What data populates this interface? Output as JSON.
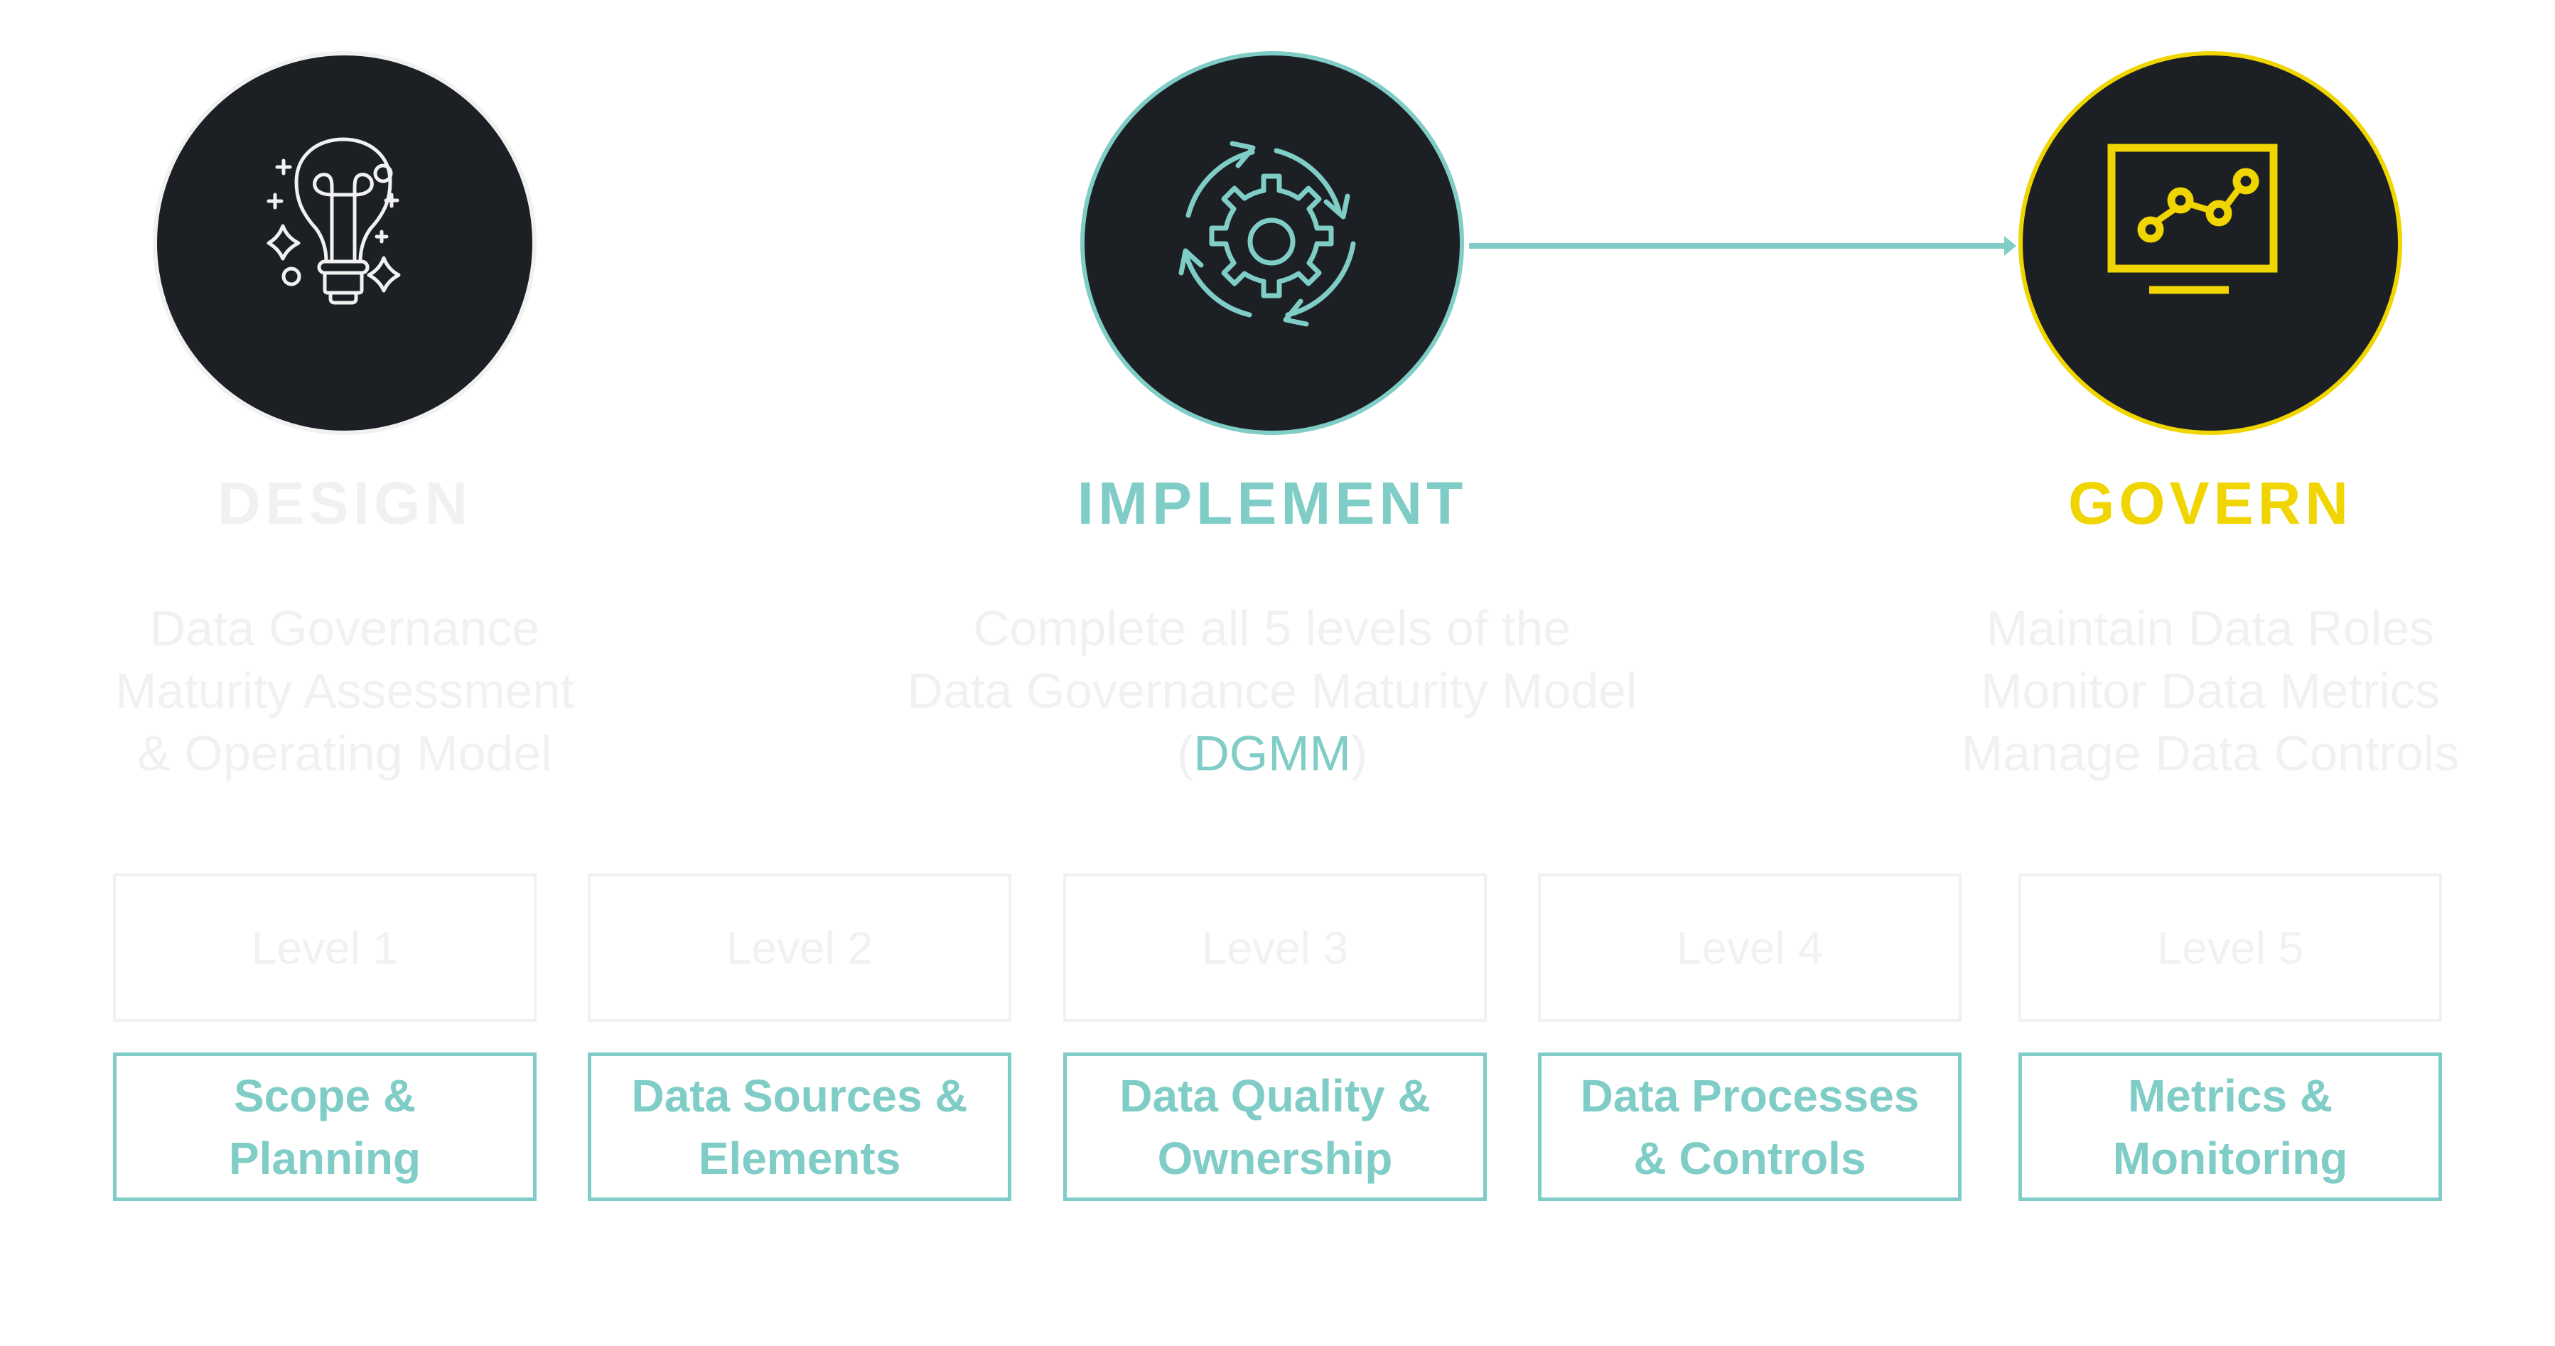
{
  "colors": {
    "circle_fill": "#1c2024",
    "teal": "#7fcdc6",
    "yellow": "#f0d500",
    "light_gray": "#f1f1f1"
  },
  "phases": [
    {
      "id": "design",
      "title": "DESIGN",
      "icon": "lightbulb-icon",
      "description": [
        "Data Governance",
        "Maturity Assessment",
        "& Operating Model"
      ]
    },
    {
      "id": "implement",
      "title": "IMPLEMENT",
      "icon": "gear-cycle-icon",
      "description": [
        "Complete all 5 levels of the",
        "Data Governance Maturity Model"
      ],
      "description_open": "(",
      "description_highlight": "DGMM",
      "description_close": ")"
    },
    {
      "id": "govern",
      "title": "GOVERN",
      "icon": "monitor-chart-icon",
      "description": [
        "Maintain Data Roles",
        "Monitor Data Metrics",
        "Manage Data Controls"
      ]
    }
  ],
  "connector": {
    "from": "implement",
    "to": "govern",
    "icon": "arrow-right-icon"
  },
  "levels": [
    {
      "label": "Level 1",
      "topic_line1": "Scope &",
      "topic_line2": "Planning"
    },
    {
      "label": "Level 2",
      "topic_line1": "Data Sources &",
      "topic_line2": "Elements"
    },
    {
      "label": "Level 3",
      "topic_line1": "Data Quality &",
      "topic_line2": "Ownership"
    },
    {
      "label": "Level 4",
      "topic_line1": "Data Processes",
      "topic_line2": "& Controls"
    },
    {
      "label": "Level 5",
      "topic_line1": "Metrics &",
      "topic_line2": "Monitoring"
    }
  ]
}
